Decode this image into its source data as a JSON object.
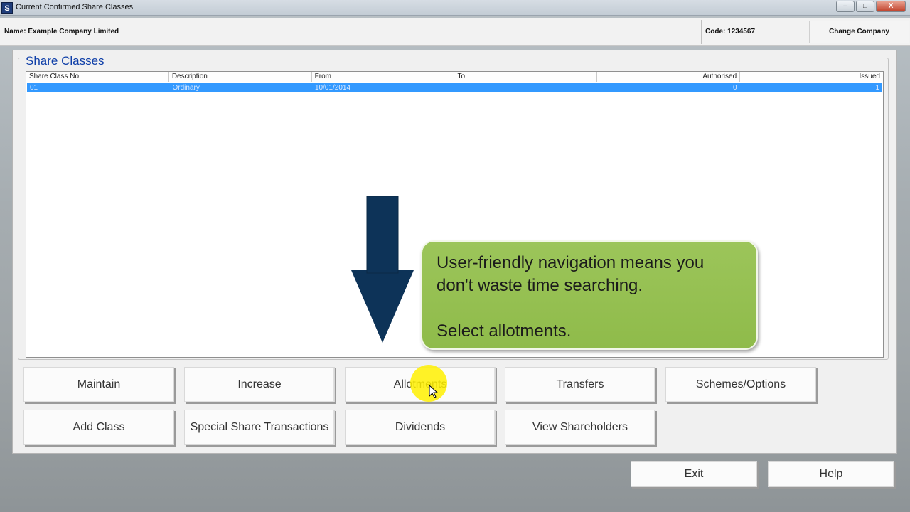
{
  "window": {
    "title": "Current Confirmed Share Classes",
    "icon_letter": "S",
    "controls": [
      "–",
      "□",
      "X"
    ]
  },
  "infobar": {
    "name": "Name: Example Company Limited",
    "code": "Code: 1234567",
    "change_company": "Change Company"
  },
  "group": {
    "title": "Share Classes"
  },
  "table": {
    "columns": [
      "Share Class No.",
      "Description",
      "From",
      "To",
      "Authorised",
      "Issued"
    ],
    "rows": [
      [
        "01",
        "Ordinary",
        "10/01/2014",
        "",
        "0",
        "1"
      ]
    ]
  },
  "buttons": {
    "row1": [
      "Maintain",
      "Increase",
      "Allotments",
      "Transfers",
      "Schemes/Options"
    ],
    "row2": [
      "Add Class",
      "Special Share Transactions",
      "Dividends",
      "View Shareholders"
    ],
    "exit": "Exit",
    "help": "Help"
  },
  "callout": {
    "line1": "User-friendly navigation means you",
    "line2": "don't waste time searching.",
    "line3": "Select allotments.",
    "color": "#94c050"
  },
  "colors": {
    "selection": "#3399ff",
    "group_title": "#0f3fa8",
    "arrow": "#0d3358",
    "highlight": "#fff000"
  },
  "icons": {
    "arrow": "down-arrow-icon",
    "cursor": "mouse-pointer-icon"
  }
}
